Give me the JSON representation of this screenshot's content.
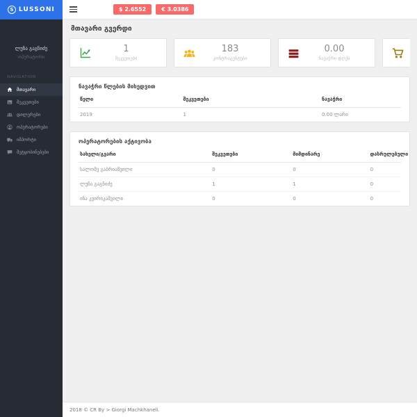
{
  "logo": {
    "brand": "LUSSONI",
    "mark": "S"
  },
  "header": {
    "badges": [
      {
        "name": "usd-rate",
        "label": "$ 2.6552"
      },
      {
        "name": "eur-rate",
        "label": "€ 3.0386"
      }
    ]
  },
  "colors": {
    "brand_blue": "#2d72e8",
    "badge_red": "#f8696a",
    "sidebar_bg": "#262b34",
    "stat_green": "#3fa548",
    "stat_orange": "#fbb016",
    "stat_maroon": "#8e1c1c",
    "stat_olive": "#9c7c10"
  },
  "sidebar": {
    "user": {
      "name": "ლუნა გაგნიძე",
      "role": "ოპერატორი"
    },
    "section_label": "NAVIGATION",
    "items": [
      {
        "label": "მთავარი",
        "icon": "home-icon",
        "active": true
      },
      {
        "label": "შეკვეთები",
        "icon": "orders-icon",
        "active": false
      },
      {
        "label": "დილერები",
        "icon": "users-icon",
        "active": false
      },
      {
        "label": "ოპერატორები",
        "icon": "operator-icon",
        "active": false
      },
      {
        "label": "იმპორტი",
        "icon": "truck-icon",
        "active": false
      },
      {
        "label": "შეტყობინებები",
        "icon": "messages-icon",
        "active": false
      }
    ]
  },
  "page": {
    "title": "მთავარი გვერდი"
  },
  "cards": [
    {
      "value": "1",
      "label": "შეკვეთები",
      "icon": "chart-line-icon",
      "color": "#3fa548"
    },
    {
      "value": "183",
      "label": "კონტრაგენტები",
      "icon": "users-icon",
      "color": "#fbb016"
    },
    {
      "value": "0.00",
      "label": "ნავაჭრი დღეს",
      "icon": "money-icon",
      "color": "#8e1c1c"
    },
    {
      "value": "",
      "label": "",
      "icon": "cart-icon",
      "color": "#9c7c10"
    }
  ],
  "sales_table": {
    "title": "ნავაჭრი წლების მიხედვით",
    "columns": [
      "წელი",
      "შეკვეთები",
      "ნავაჭრი"
    ],
    "rows": [
      [
        "2019",
        "1",
        "0.00 ლარი"
      ]
    ]
  },
  "operators_table": {
    "title": "ოპერატორების აქტივობა",
    "columns": [
      "სახელი/გვარი",
      "შეკვეთები",
      "მიმდინარე",
      "დასრულებული"
    ],
    "rows": [
      [
        "სალომე გაბრიაშვილი",
        "0",
        "0",
        "0"
      ],
      [
        "ლუნა გაგნიძე",
        "1",
        "1",
        "0"
      ],
      [
        "ინა კვირიკაშვილი",
        "0",
        "0",
        "0"
      ]
    ]
  },
  "footer": {
    "text": "2018 © CR By > Giorgi Machkhaneli."
  }
}
